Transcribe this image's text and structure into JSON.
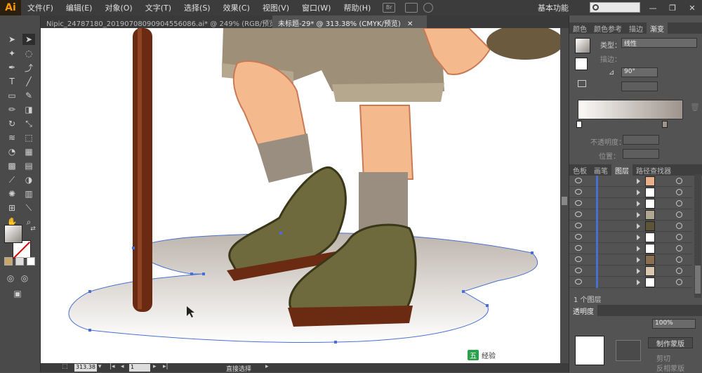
{
  "app": {
    "logo": "Ai",
    "menu": [
      "文件(F)",
      "编辑(E)",
      "对象(O)",
      "文字(T)",
      "选择(S)",
      "效果(C)",
      "视图(V)",
      "窗口(W)",
      "帮助(H)"
    ],
    "toolbar_badge": "Br",
    "workspace_label": "基本功能",
    "search_placeholder": "",
    "window_controls": [
      "—",
      "❐",
      "✕"
    ]
  },
  "document_tabs": [
    {
      "label": "Nipic_24787180_20190708090904556086.ai* @ 249% (RGB/预览)",
      "close": "✕"
    },
    {
      "label": "未标题-29* @ 313.38% (CMYK/预览)",
      "close": "✕"
    }
  ],
  "status_bar": {
    "zoom": "313.38",
    "page": "1",
    "current_tool": "直接选择"
  },
  "right_panel": {
    "top_tabs": [
      "颜色",
      "颜色参考",
      "描边",
      "渐变"
    ],
    "active_top_tab": "渐变",
    "gradient": {
      "type_label": "类型：",
      "type_value": "线性",
      "stroke_label": "描边：",
      "angle_value": "90°",
      "opacity_label": "不透明度：",
      "position_label": "位置："
    },
    "layer_tabs": [
      "色板",
      "画笔",
      "图层",
      "路径查找器"
    ],
    "active_layer_tab": "图层",
    "layer_count": "1 个图层",
    "bottom_tab": "透明度",
    "opacity_value": "100%",
    "make_mask_button": "制作蒙版",
    "clip_label": "剪切",
    "invert_mask_label": "反相蒙版"
  },
  "layer_thumb_colors": [
    "#e8b08a",
    "#ffffff",
    "#ffffff",
    "#b0a890",
    "#5d5538",
    "#ffffff",
    "#ffffff",
    "#8a7050",
    "#d8c8b0",
    "#ffffff"
  ],
  "watermark": {
    "badge_text": "五",
    "brand_text": "经验"
  },
  "colors": {
    "selection": "#4a6fd3",
    "staff": "#6b2a12",
    "shoe": "#6f6a3e",
    "shorts": "#9e9078",
    "skin": "#f4b98c",
    "sock": "#9a8e80"
  }
}
